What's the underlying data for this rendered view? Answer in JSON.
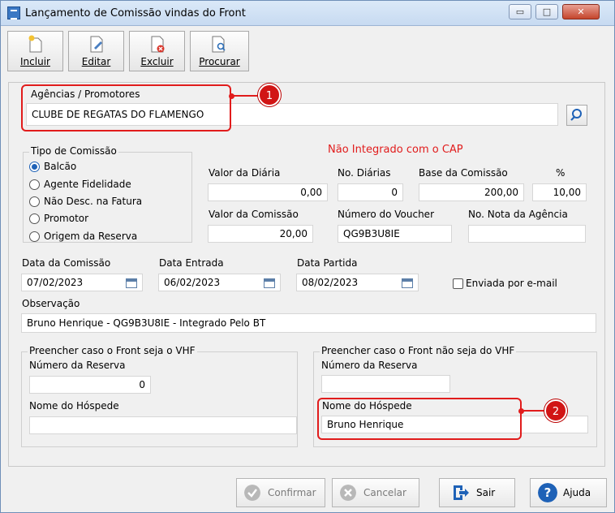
{
  "window": {
    "title": "Lançamento de Comissão vindas do Front",
    "controls": {
      "minimize": "▭",
      "maximize": "□",
      "close": "✕"
    }
  },
  "toolbar": {
    "incluir": "Incluir",
    "editar": "Editar",
    "excluir": "Excluir",
    "procurar": "Procurar"
  },
  "agencias": {
    "label": "Agências  / Promotores",
    "value": "CLUBE DE REGATAS DO FLAMENGO"
  },
  "status_text": "Não Integrado com o CAP",
  "tipo_comissao": {
    "legend": "Tipo de Comissão",
    "options": [
      "Balcão",
      "Agente Fidelidade",
      "Não Desc. na Fatura",
      "Promotor",
      "Origem da Reserva"
    ],
    "selected": "Balcão"
  },
  "valores": {
    "valor_diaria_label": "Valor da Diária",
    "valor_diaria": "0,00",
    "no_diarias_label": "No. Diárias",
    "no_diarias": "0",
    "base_comissao_label": "Base da Comissão",
    "base_comissao": "200,00",
    "percent_label": "%",
    "percent": "10,00",
    "valor_comissao_label": "Valor da Comissão",
    "valor_comissao": "20,00",
    "numero_voucher_label": "Número do Voucher",
    "numero_voucher": "QG9B3U8IE",
    "no_nota_label": "No. Nota da Agência",
    "no_nota": ""
  },
  "datas": {
    "data_comissao_label": "Data da Comissão",
    "data_comissao": "07/02/2023",
    "data_entrada_label": "Data Entrada",
    "data_entrada": "06/02/2023",
    "data_partida_label": "Data Partida",
    "data_partida": "08/02/2023",
    "enviada_email_label": "Enviada por e-mail"
  },
  "observacao": {
    "label": "Observação",
    "value": "Bruno Henrique - QG9B3U8IE -  Integrado Pelo BT"
  },
  "vhf_group": {
    "legend": "Preencher caso o Front seja o VHF",
    "numero_reserva_label": "Número da Reserva",
    "numero_reserva": "0",
    "nome_hospede_label": "Nome do Hóspede",
    "nome_hospede": ""
  },
  "nao_vhf_group": {
    "legend": "Preencher caso o Front não seja do VHF",
    "numero_reserva_label": "Número da Reserva",
    "numero_reserva": "",
    "nome_hospede_label": "Nome do Hóspede",
    "nome_hospede": "Bruno Henrique"
  },
  "callouts": {
    "one": "1",
    "two": "2"
  },
  "buttons": {
    "confirmar": "Confirmar",
    "cancelar": "Cancelar",
    "sair": "Sair",
    "ajuda": "Ajuda"
  },
  "colors": {
    "accent": "#1f62b7",
    "callout": "#e11c1c",
    "status": "#e11c1c"
  }
}
